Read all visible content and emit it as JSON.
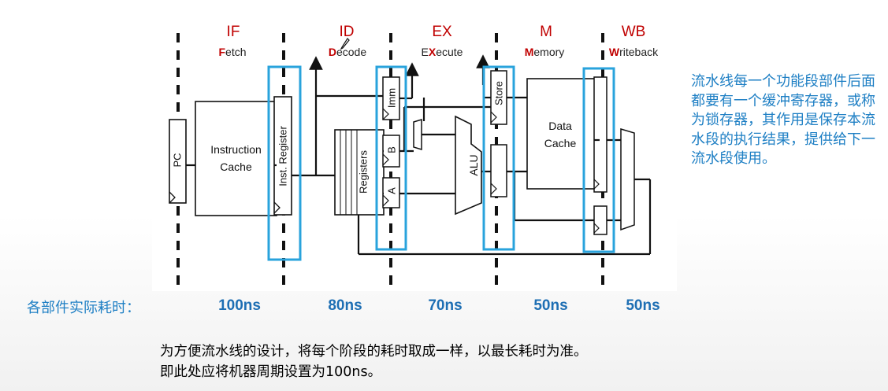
{
  "stages": [
    {
      "name": "IF",
      "sub_hl": "F",
      "sub_rest": "etch"
    },
    {
      "name": "ID",
      "sub_hl": "D",
      "sub_rest": "ecode"
    },
    {
      "name": "EX",
      "sub_pre": "E",
      "sub_hl": "X",
      "sub_rest": "ecute"
    },
    {
      "name": "M",
      "sub_hl": "M",
      "sub_rest": "emory"
    },
    {
      "name": "WB",
      "sub_hl": "W",
      "sub_rest": "riteback"
    }
  ],
  "components": {
    "pc": "PC",
    "icache_line1": "Instruction",
    "icache_line2": "Cache",
    "inst_register": "Inst. Register",
    "registers": "Registers",
    "imm": "Imm",
    "b": "B",
    "a": "A",
    "alu": "ALU",
    "store": "Store",
    "dcache_line1": "Data",
    "dcache_line2": "Cache"
  },
  "note": "流水线每一个功能段部件后面都要有一个缓冲寄存器，或称为锁存器，其作用是保存本流水段的执行结果，提供给下一流水段使用。",
  "timing": {
    "title": "各部件实际耗时：",
    "values": [
      "100ns",
      "80ns",
      "70ns",
      "50ns",
      "50ns"
    ]
  },
  "conclusion": {
    "line1": "为方便流水线的设计，将每个阶段的耗时取成一样，以最长耗时为准。",
    "line2": "即此处应将机器周期设置为100ns。"
  },
  "colors": {
    "stage_title": "#c00000",
    "latch_box": "#29a3dc",
    "note_text": "#1e7fc4"
  }
}
